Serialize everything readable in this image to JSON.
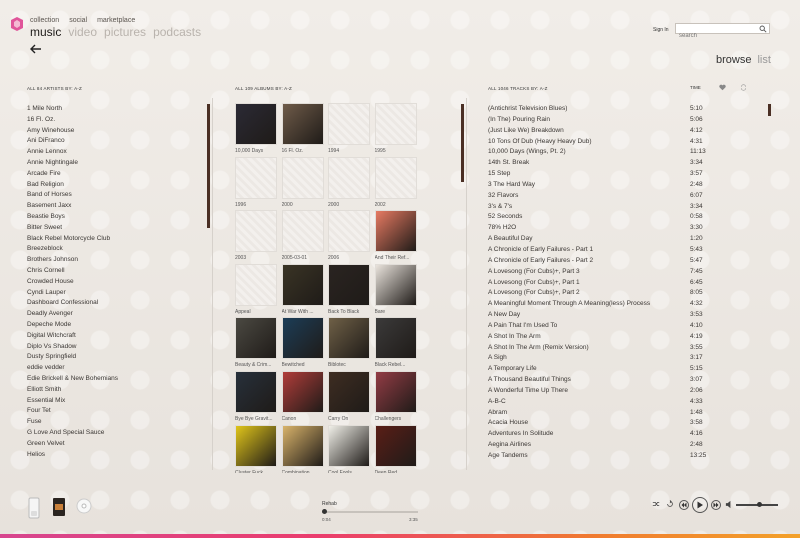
{
  "nav": {
    "sub": [
      "collection",
      "social",
      "marketplace"
    ],
    "main": [
      "music",
      "video",
      "pictures",
      "podcasts"
    ],
    "active": "music"
  },
  "header": {
    "signin": "Sign In",
    "search_placeholder": "search",
    "view_browse": "browse",
    "view_list": "list"
  },
  "columns": {
    "artists_header": "ALL 84 ARTISTS  BY: A-Z",
    "albums_header": "ALL 109 ALBUMS  BY: A-Z",
    "tracks_header": "ALL 1046 TRACKS  BY: A-Z",
    "time_header": "TIME"
  },
  "artists": [
    "1 Mile North",
    "16 Fl. Oz.",
    "Amy Winehouse",
    "Ani DiFranco",
    "Annie Lennox",
    "Annie Nightingale",
    "Arcade Fire",
    "Bad Religion",
    "Band of Horses",
    "Basement Jaxx",
    "Beastie Boys",
    "Bitter Sweet",
    "Black Rebel Motorcycle Club",
    "Breezeblock",
    "Brothers Johnson",
    "Chris Cornell",
    "Crowded House",
    "Cyndi Lauper",
    "Dashboard Confessional",
    "Deadly Avenger",
    "Depeche Mode",
    "Digital Witchcraft",
    "Diplo Vs Shadow",
    "Dusty Springfield",
    "eddie vedder",
    "Edie Brickell & New Bohemians",
    "Elliott Smith",
    "Essential Mix",
    "Four Tet",
    "Fuse",
    "G Love And Special Sauce",
    "Green Velvet",
    "Helios"
  ],
  "albums": [
    {
      "title": "10,000 Days",
      "cover": "#2b2a35"
    },
    {
      "title": "16 Fl. Oz.",
      "cover": "#6f5b49"
    },
    {
      "title": "1994",
      "cover": ""
    },
    {
      "title": "1995",
      "cover": ""
    },
    {
      "title": "1996",
      "cover": ""
    },
    {
      "title": "2000",
      "cover": ""
    },
    {
      "title": "2000",
      "cover": ""
    },
    {
      "title": "2002",
      "cover": ""
    },
    {
      "title": "2003",
      "cover": ""
    },
    {
      "title": "2005-03-01",
      "cover": ""
    },
    {
      "title": "2006",
      "cover": ""
    },
    {
      "title": "And Their Ref...",
      "cover": "#e77a62"
    },
    {
      "title": "Appeal",
      "cover": ""
    },
    {
      "title": "At War With ...",
      "cover": "#3a3425"
    },
    {
      "title": "Back To Black",
      "cover": "#2a2421"
    },
    {
      "title": "Bare",
      "cover": "#e9e3dc"
    },
    {
      "title": "Beauty & Crim...",
      "cover": "#4b4942"
    },
    {
      "title": "Bewitched",
      "cover": "#1c3d57"
    },
    {
      "title": "Biblotec",
      "cover": "#6f6047"
    },
    {
      "title": "Black Rebel...",
      "cover": "#3b3a3a"
    },
    {
      "title": "Bye Bye Gravit...",
      "cover": "#27303b"
    },
    {
      "title": "Canon",
      "cover": "#b13d3a"
    },
    {
      "title": "Carry On",
      "cover": "#3e2d22"
    },
    {
      "title": "Challengers",
      "cover": "#933c45"
    },
    {
      "title": "Cluster Fuck",
      "cover": "#e0c51a"
    },
    {
      "title": "Combination",
      "cover": "#d9b36a"
    },
    {
      "title": "Cool Fools",
      "cover": "#f0efe8"
    },
    {
      "title": "Deep Red",
      "cover": "#5a1e17"
    }
  ],
  "tracks": [
    {
      "title": "(Antichrist Television Blues)",
      "time": "5:10"
    },
    {
      "title": "(In The) Pouring Rain",
      "time": "5:06"
    },
    {
      "title": "(Just Like We) Breakdown",
      "time": "4:12"
    },
    {
      "title": "10 Tons Of Dub (Heavy Heavy Dub)",
      "time": "4:31"
    },
    {
      "title": "10,000 Days (Wings, Pt. 2)",
      "time": "11:13"
    },
    {
      "title": "14th St. Break",
      "time": "3:34"
    },
    {
      "title": "15 Step",
      "time": "3:57"
    },
    {
      "title": "3 The Hard Way",
      "time": "2:48"
    },
    {
      "title": "32 Flavors",
      "time": "6:07"
    },
    {
      "title": "3's & 7's",
      "time": "3:34"
    },
    {
      "title": "52 Seconds",
      "time": "0:58"
    },
    {
      "title": "78% H2O",
      "time": "3:30"
    },
    {
      "title": "A Beautiful Day",
      "time": "1:20"
    },
    {
      "title": "A Chronicle of Early Failures - Part 1",
      "time": "5:43"
    },
    {
      "title": "A Chronicle of Early Failures - Part 2",
      "time": "5:47"
    },
    {
      "title": "A Lovesong (For Cubs)+, Part  3",
      "time": "7:45"
    },
    {
      "title": "A Lovesong (For Cubs)+, Part 1",
      "time": "6:45"
    },
    {
      "title": "A Lovesong (For Cubs)+, Part 2",
      "time": "8:05"
    },
    {
      "title": "A Meaningful Moment Through A Meaning(less) Process",
      "time": "4:32"
    },
    {
      "title": "A New Day",
      "time": "3:53"
    },
    {
      "title": "A Pain That I'm Used To",
      "time": "4:10"
    },
    {
      "title": "A Shot In The Arm",
      "time": "4:19"
    },
    {
      "title": "A Shot In The Arm (Remix Version)",
      "time": "3:55"
    },
    {
      "title": "A Sigh",
      "time": "3:17"
    },
    {
      "title": "A Temporary Life",
      "time": "5:15"
    },
    {
      "title": "A Thousand Beautiful Things",
      "time": "3:07"
    },
    {
      "title": "A Wonderful Time Up There",
      "time": "2:06"
    },
    {
      "title": "A-B-C",
      "time": "4:33"
    },
    {
      "title": "Abram",
      "time": "1:48"
    },
    {
      "title": "Acacia House",
      "time": "3:58"
    },
    {
      "title": "Adventures In Solitude",
      "time": "4:16"
    },
    {
      "title": "Aegina Airlines",
      "time": "2:48"
    },
    {
      "title": "Age Tandems",
      "time": "13:25"
    }
  ],
  "player": {
    "now_playing": "Rehab",
    "elapsed": "0:04",
    "total": "3:35",
    "progress": 0.02,
    "volume": 0.55
  },
  "colors": {
    "accent_pink": "#d7468f",
    "accent_orange": "#f3a12a",
    "scroll": "#4a2f24"
  }
}
